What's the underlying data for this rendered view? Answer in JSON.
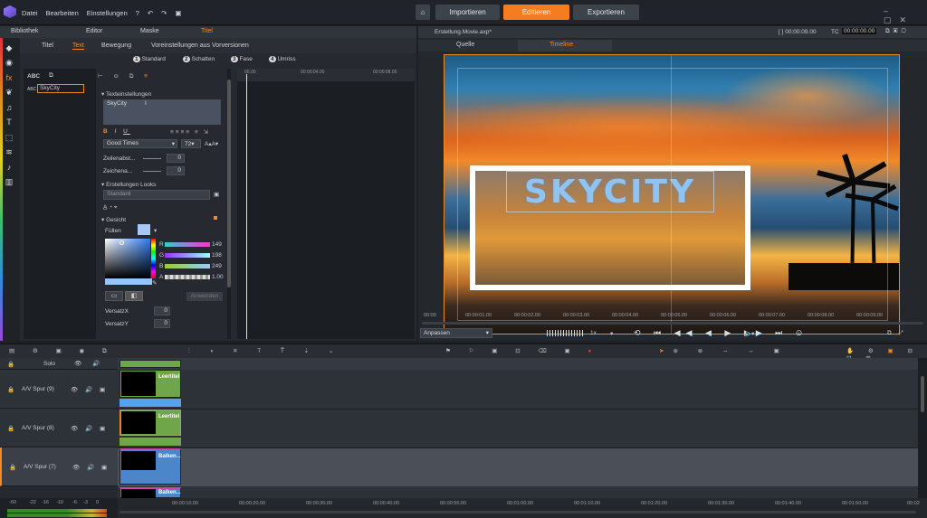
{
  "menu": {
    "datei": "Datei",
    "bearbeiten": "Bearbeiten",
    "einstellungen": "Einstellungen"
  },
  "nav": {
    "import": "Importieren",
    "edit": "Editieren",
    "export": "Exportieren"
  },
  "left_tabs": {
    "library": "Bibliothek",
    "editor": "Editor",
    "mask": "Maske",
    "title": "Titel"
  },
  "sub_tabs": {
    "titel": "Titel",
    "text": "Text",
    "bewegung": "Bewegung",
    "presets": "Voreinstellungen aus Vorversionen"
  },
  "style_steps": [
    {
      "n": "1",
      "label": "Standard"
    },
    {
      "n": "2",
      "label": "Schatten"
    },
    {
      "n": "3",
      "label": "Fase"
    },
    {
      "n": "4",
      "label": "Umriss"
    }
  ],
  "layer": {
    "abc": "ABC",
    "name": "SkyCity"
  },
  "ruler_left": {
    "t0": "00.00",
    "t1": "00:00:04.00",
    "t2": "00:00:08.00"
  },
  "text_settings": {
    "header": "Texteinstellungen",
    "text_value": "SkyCity",
    "font": "Good Times",
    "size": "72",
    "line_spacing_label": "Zeilenabst...",
    "line_spacing_val": "0",
    "char_spacing_label": "Zeichena...",
    "char_spacing_val": "0"
  },
  "looks": {
    "header": "Erstellungen Looks",
    "preset": "Standard"
  },
  "face": {
    "header": "Gesicht",
    "fill_label": "Füllen",
    "fill_color": "#a7c8f5"
  },
  "color": {
    "r_label": "R",
    "r": "149",
    "g_label": "G",
    "g": "198",
    "b_label": "B",
    "b": "249",
    "a_label": "A",
    "a": "1.00",
    "apply": "Anwenden"
  },
  "offset": {
    "x_label": "VersatzX",
    "x": "0",
    "y_label": "VersatzY",
    "y": "0"
  },
  "preview": {
    "file": "Erstellung.Movie.axp*",
    "timecode_label": "TC",
    "dur": "[ ] 00:00:09.00",
    "tc": "00:00:00.00",
    "tab_source": "Quelle",
    "tab_timeline": "Timeline",
    "title_text": "SKYCITY",
    "fit": "Anpassen",
    "speed": "1x"
  },
  "preview_ruler": [
    "00:00",
    "00:00:01.00",
    "00:00:02.00",
    "00:00:03.00",
    "00:00:04.00",
    "00:00:05.00",
    "00:00:06.00",
    "00:00:07.00",
    "00:00:08.00",
    "00:00:09.00"
  ],
  "tracks": [
    {
      "name": "Solo",
      "clip": ""
    },
    {
      "name": "A/V Spur (9)",
      "clip": "Leertitel"
    },
    {
      "name": "A/V Spur (8)",
      "clip": "Leertitel"
    },
    {
      "name": "A/V Spur (7)",
      "clip": "Balken..."
    },
    {
      "name": "",
      "clip": "Balken..."
    }
  ],
  "timeline_ruler": [
    "00:00:10.00",
    "00:00:20.00",
    "00:00:30.00",
    "00:00:40.00",
    "00:00:50.00",
    "00:01:00.00",
    "00:01:10.00",
    "00:01:20.00",
    "00:01:30.00",
    "00:01:40.00",
    "00:01:50.00",
    "00:02"
  ],
  "meter": [
    "-60",
    "-22",
    "-16",
    "-10",
    "-6",
    "-3",
    "0"
  ],
  "colors": {
    "accent": "#f57c1f",
    "title_blue": "#8fc3f2",
    "clip_green": "#6fa64a",
    "clip_blue": "#4a86c9"
  }
}
